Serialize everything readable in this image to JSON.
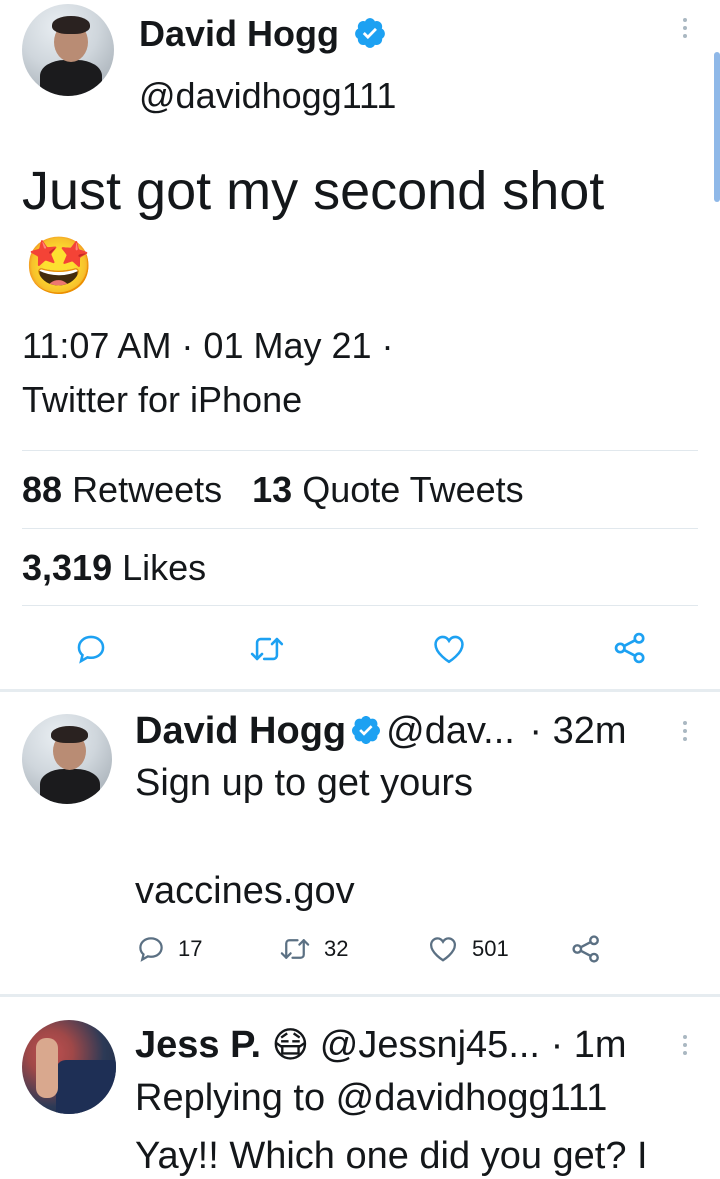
{
  "main_tweet": {
    "author_name": "David Hogg",
    "handle": "@davidhogg111",
    "text": "Just got my second shot",
    "emoji": "🤩",
    "timestamp": "11:07 AM · 01 May 21 ·",
    "source": "Twitter for iPhone",
    "retweets_count": "88",
    "retweets_label": "Retweets",
    "quotes_count": "13",
    "quotes_label": "Quote Tweets",
    "likes_count": "3,319",
    "likes_label": "Likes"
  },
  "reply_1": {
    "author_name": "David Hogg",
    "handle": "@dav...",
    "time": "· 32m",
    "line1": "Sign up to get yours",
    "line2": "vaccines.gov",
    "reply_count": "17",
    "retweet_count": "32",
    "like_count": "501"
  },
  "reply_2": {
    "author_name": "Jess P.",
    "emoji": "😷",
    "handle": "@Jessnj45...",
    "time": "· 1m",
    "replying_to": "Replying to @davidhogg111",
    "text": "Yay!! Which one did you get? I"
  },
  "colors": {
    "verified": "#1da1f2",
    "icon_gray": "#5b7083",
    "action_blue": "#1da1f2",
    "text": "#14171a",
    "divider": "#e1e8ed"
  },
  "icons": [
    "verified-badge-icon",
    "more-icon",
    "reply-icon",
    "retweet-icon",
    "like-icon",
    "share-icon",
    "mask-emoji-icon"
  ]
}
